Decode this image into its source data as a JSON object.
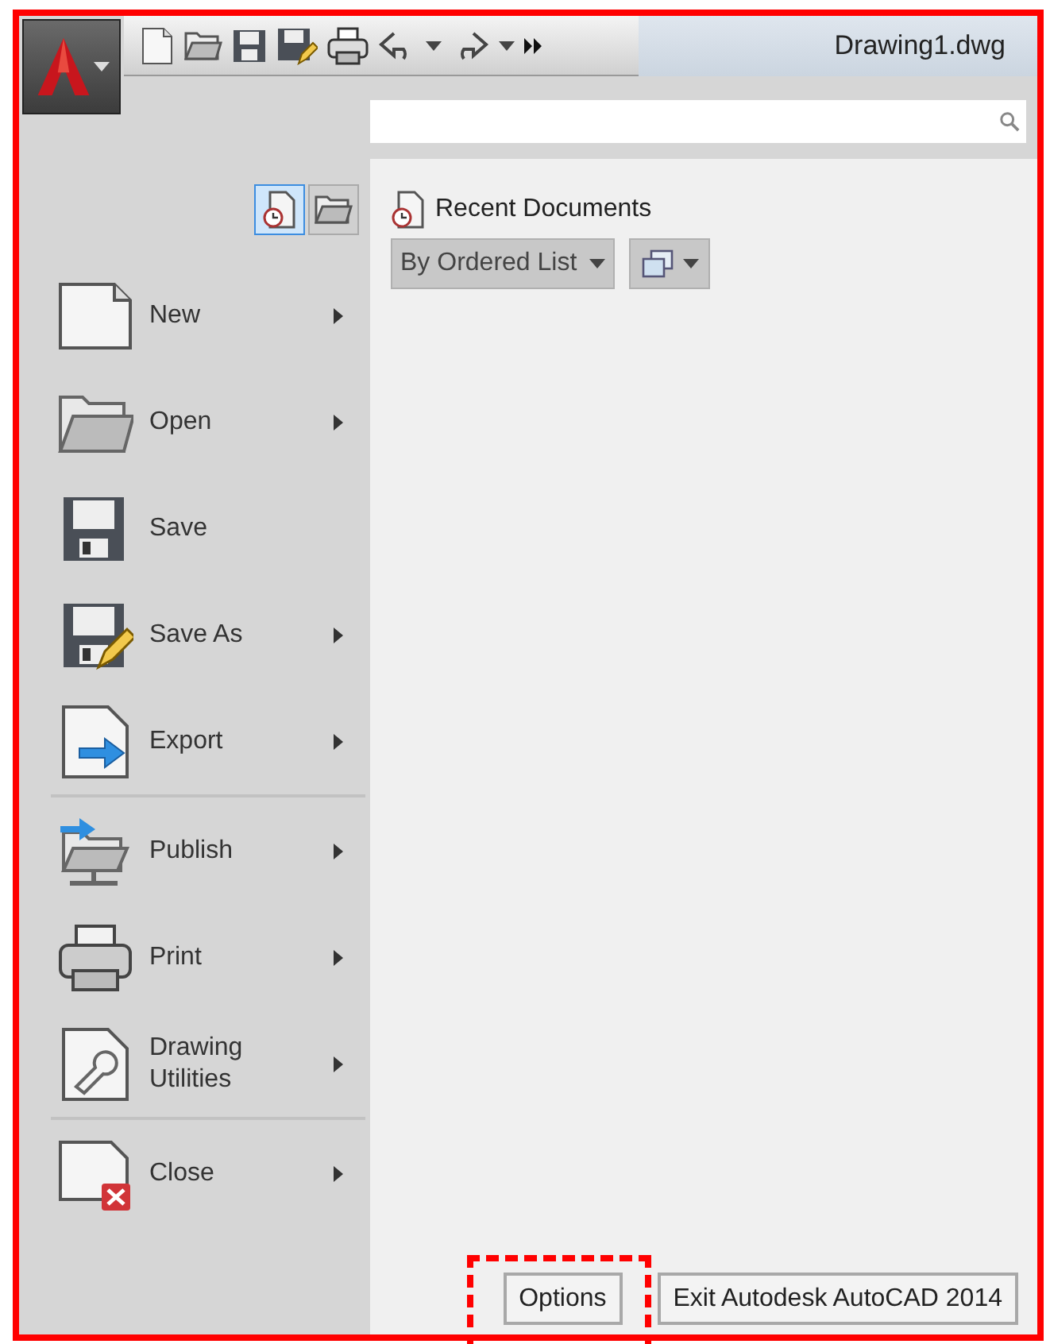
{
  "window": {
    "title": "Drawing1.dwg"
  },
  "view_toggles": [
    {
      "selected": true
    },
    {
      "selected": false
    }
  ],
  "menu_groups": [
    [
      {
        "kind": "new",
        "label": "New",
        "submenu": true
      },
      {
        "kind": "open",
        "label": "Open",
        "submenu": true
      },
      {
        "kind": "save",
        "label": "Save",
        "submenu": false
      },
      {
        "kind": "saveas",
        "label": "Save As",
        "submenu": true
      },
      {
        "kind": "export",
        "label": "Export",
        "submenu": true
      }
    ],
    [
      {
        "kind": "publish",
        "label": "Publish",
        "submenu": true
      },
      {
        "kind": "print",
        "label": "Print",
        "submenu": true
      },
      {
        "kind": "utilities",
        "label": "Drawing Utilities",
        "submenu": true
      }
    ],
    [
      {
        "kind": "close",
        "label": "Close",
        "submenu": true
      }
    ]
  ],
  "recent_documents": {
    "title": "Recent Documents",
    "sort": "By Ordered List"
  },
  "buttons": [
    {
      "label": "Options",
      "highlighted": true
    },
    {
      "label": "Exit Autodesk AutoCAD 2014",
      "highlighted": false
    }
  ]
}
